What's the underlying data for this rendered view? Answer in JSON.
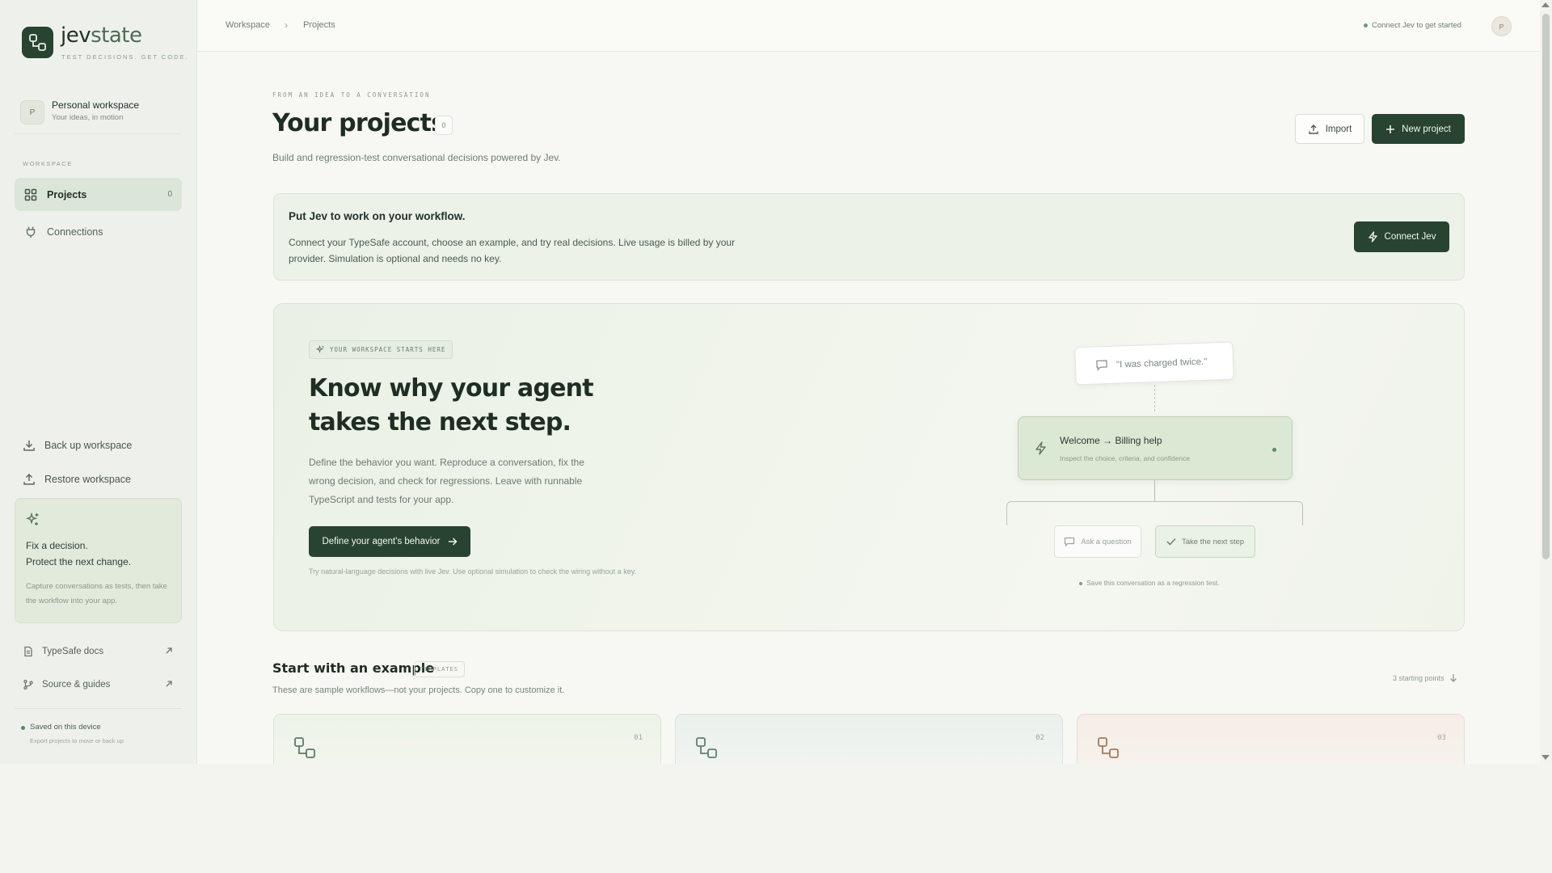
{
  "brand": {
    "name_bold": "jev",
    "name_light": "state",
    "tagline": "TEST DECISIONS. GET CODE."
  },
  "workspace": {
    "avatar": "P",
    "name": "Personal workspace",
    "sub": "Your ideas, in motion"
  },
  "sidebar": {
    "section_label": "WORKSPACE",
    "items": [
      {
        "label": "Projects",
        "count": "0",
        "icon": "grid-icon",
        "active": true
      },
      {
        "label": "Connections",
        "icon": "plug-icon"
      }
    ],
    "actions": [
      {
        "label": "Back up workspace",
        "icon": "download-icon"
      },
      {
        "label": "Restore workspace",
        "icon": "upload-icon"
      }
    ],
    "promo": {
      "line1": "Fix a decision.",
      "line2": "Protect the next change.",
      "text": "Capture conversations as tests, then take the workflow into your app."
    },
    "links": [
      {
        "label": "TypeSafe docs",
        "icon": "document-icon"
      },
      {
        "label": "Source & guides",
        "icon": "branch-icon"
      }
    ],
    "saved": {
      "title": "Saved on this device",
      "sub": "Export projects to move or back up"
    }
  },
  "topbar": {
    "breadcrumb": [
      "Workspace",
      "Projects"
    ],
    "status": "Connect Jev to get started",
    "avatar": "P"
  },
  "main": {
    "eyebrow": "FROM AN IDEA TO A CONVERSATION",
    "title": "Your projects",
    "count": "0",
    "subtitle": "Build and regression-test conversational decisions powered by Jev.",
    "import_label": "Import",
    "new_project_label": "New project"
  },
  "banner": {
    "title": "Put Jev to work on your workflow.",
    "text": "Connect your TypeSafe account, choose an example, and try real decisions. Live usage is billed by your provider. Simulation is optional and needs no key.",
    "button": "Connect Jev"
  },
  "hero": {
    "chip": "YOUR WORKSPACE STARTS HERE",
    "line1": "Know why your agent",
    "line2": "takes the next step.",
    "text": "Define the behavior you want. Reproduce a conversation, fix the wrong decision, and check for regressions. Leave with runnable TypeScript and tests for your app.",
    "button": "Define your agent's behavior",
    "note": "Try natural-language decisions with live Jev. Use optional simulation to check the wiring without a key.",
    "diagram": {
      "quote": "\"I was charged twice.\"",
      "decision_title": "Welcome → Billing help",
      "decision_sub": "Inspect the choice, criteria, and confidence",
      "option_a": "Ask a question",
      "option_b": "Take the next step",
      "save_note": "Save this conversation as a regression test."
    }
  },
  "examples": {
    "title": "Start with an example",
    "chip": "TEMPLATES",
    "subtitle": "These are sample workflows—not your projects. Copy one to customize it.",
    "count_label": "3 starting points",
    "cards": [
      {
        "num": "01"
      },
      {
        "num": "02"
      },
      {
        "num": "03"
      }
    ]
  },
  "colors": {
    "accent": "#28432f",
    "sidebar_bg": "#eef1eb",
    "banner_bg": "#ecf2e8",
    "decision_bg": "#dbe8d4"
  }
}
